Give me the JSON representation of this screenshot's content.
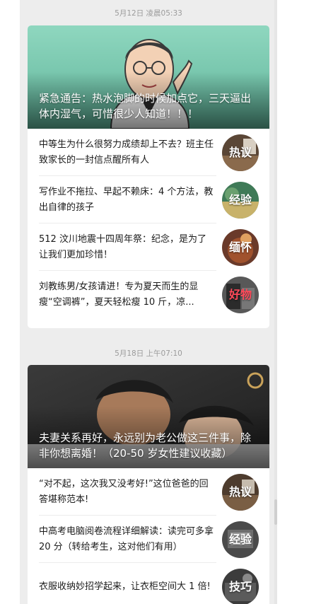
{
  "feed": {
    "groups": [
      {
        "timestamp": "5月12日 凌晨05:33",
        "hero_title": "紧急通告：热水泡脚的时候加点它，三天逼出体内湿气，可惜很少人知道！！！",
        "items": [
          {
            "text": "中等生为什么很努力成绩却上不去？班主任致家长的一封信点醒所有人",
            "tag": "热议",
            "tag_color": "#ffffff"
          },
          {
            "text": "写作业不拖拉、早起不赖床：4 个方法，教出自律的孩子",
            "tag": "经验",
            "tag_color": "#ffffff"
          },
          {
            "text": "512 汶川地震十四周年祭：纪念，是为了让我们更加珍惜！",
            "tag": "缅怀",
            "tag_color": "#ffffff"
          },
          {
            "text": "刘教练男/女孩请进！专为夏天而生的显瘦“空调裤”，夏天轻松瘦 10 斤，凉...",
            "tag": "好物",
            "tag_color": "#ff4a5a"
          }
        ]
      },
      {
        "timestamp": "5月18日 上午07:10",
        "hero_title": "夫妻关系再好，永远别为老公做这三件事，除非你想离婚！（20-50 岁女性建议收藏）",
        "items": [
          {
            "text": "“对不起，这次我又没考好!”这位爸爸的回答堪称范本!",
            "tag": "热议",
            "tag_color": "#ffffff"
          },
          {
            "text": "中高考电脑阅卷流程详细解读：读完可多拿 20 分（转给考生，这对他们有用）",
            "tag": "经验",
            "tag_color": "#ffffff"
          },
          {
            "text": "衣服收纳妙招学起来，让衣柜空间大 1 倍!",
            "tag": "技巧",
            "tag_color": "#ffffff"
          }
        ]
      }
    ]
  }
}
